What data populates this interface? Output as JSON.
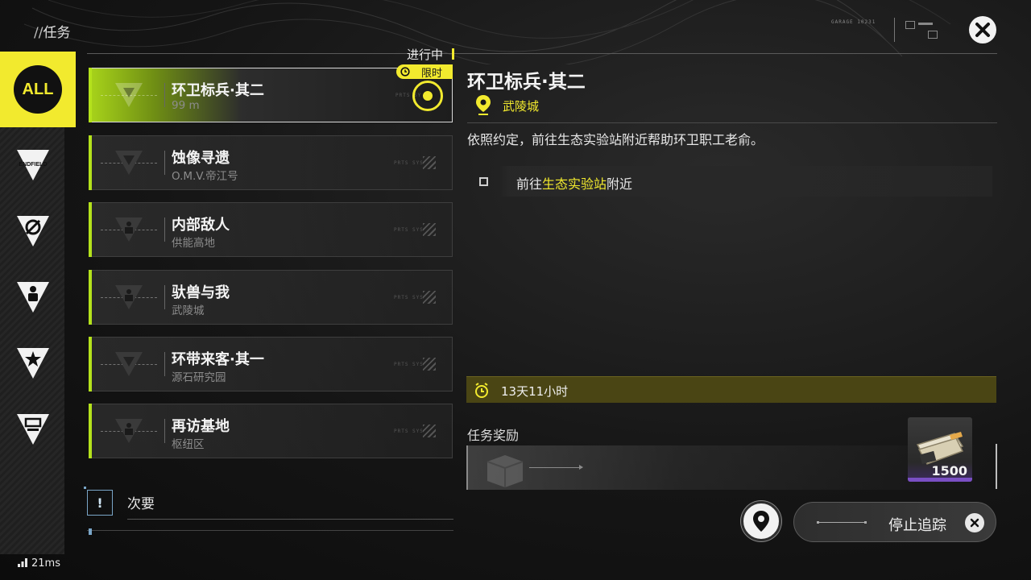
{
  "header": {
    "title_prefix": "//",
    "title": "任务",
    "decor_code": "GARAGE 10231"
  },
  "colors": {
    "accent_yellow": "#f2ea2e",
    "accent_green": "#b4e21c",
    "secondary_blue": "#7aa6c8",
    "reward_purple": "#7a4fc4"
  },
  "sidebar": {
    "items": [
      {
        "label": "ALL",
        "icon": "all-icon",
        "selected": true
      },
      {
        "label": "ENDFIELD",
        "icon": "endfield-icon",
        "selected": false
      },
      {
        "label": "",
        "icon": "leaf-triangle-icon",
        "selected": false
      },
      {
        "label": "",
        "icon": "person-triangle-icon",
        "selected": false
      },
      {
        "label": "",
        "icon": "star-triangle-icon",
        "selected": false
      },
      {
        "label": "",
        "icon": "battery-triangle-icon",
        "selected": false
      }
    ]
  },
  "list": {
    "status_label": "进行中",
    "limited_badge": "限时",
    "missions": [
      {
        "name": "环卫标兵·其二",
        "location": "99 m",
        "active": true,
        "limited": true,
        "tracked": true
      },
      {
        "name": "蚀像寻遗",
        "location": "O.M.V.帝江号",
        "active": false
      },
      {
        "name": "内部敌人",
        "location": "供能高地",
        "active": false
      },
      {
        "name": "驮兽与我",
        "location": "武陵城",
        "active": false
      },
      {
        "name": "环带来客·其一",
        "location": "源石研究园",
        "active": false
      },
      {
        "name": "再访基地",
        "location": "枢纽区",
        "active": false
      }
    ],
    "faint_code": "PRTS SYS",
    "secondary": {
      "icon_text": "!",
      "label": "次要"
    }
  },
  "detail": {
    "title": "环卫标兵·其二",
    "location": "武陵城",
    "description": "依照约定，前往生态实验站附近帮助环卫职工老俞。",
    "objective": {
      "before": "前往",
      "highlight": "生态实验站",
      "after": "附近"
    },
    "time_remaining": "13天11小时",
    "rewards_title": "任务奖励",
    "reward_item": {
      "icon": "money-bundle-icon",
      "count": "1500"
    },
    "stop_tracking_label": "停止追踪"
  },
  "status": {
    "ping": "21ms"
  }
}
